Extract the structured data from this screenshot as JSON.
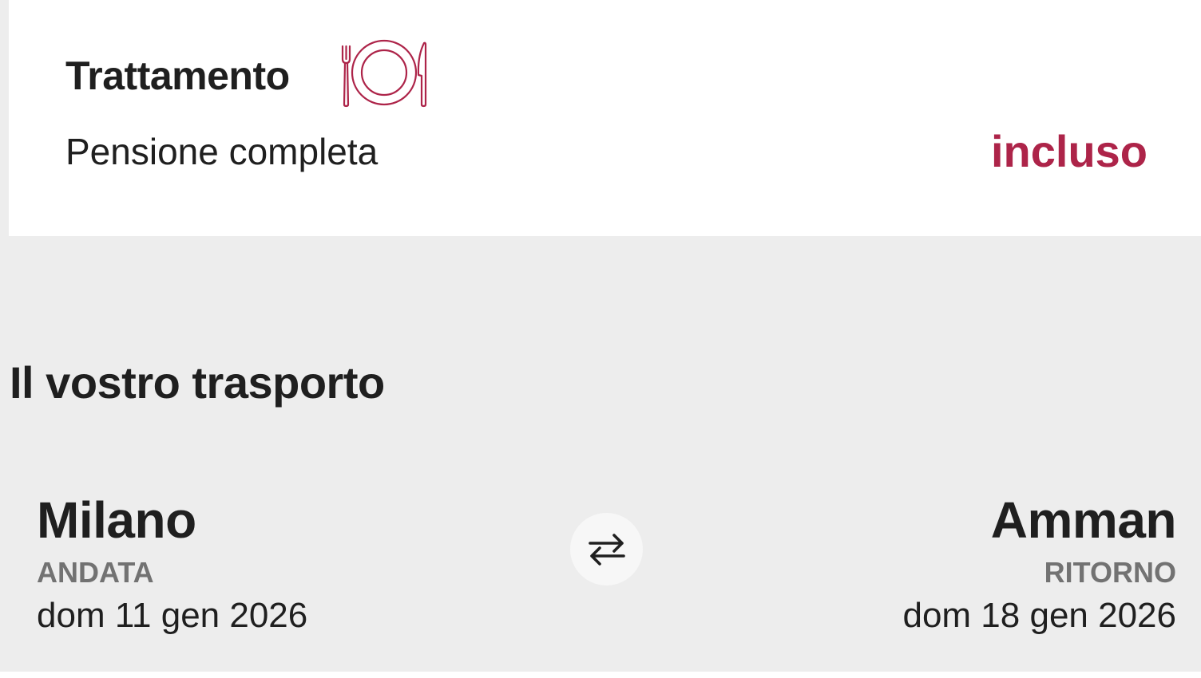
{
  "treatment": {
    "title": "Trattamento",
    "icon": "plate-cutlery-icon",
    "value": "Pensione completa",
    "status": "incluso",
    "accent_color": "#ad2449"
  },
  "transport": {
    "section_title": "Il vostro trasporto",
    "outbound": {
      "city": "Milano",
      "label": "ANDATA",
      "date": "dom 11 gen 2026"
    },
    "swap_icon": "swap-arrows-icon",
    "return": {
      "city": "Amman",
      "label": "RITORNO",
      "date": "dom 18 gen 2026"
    }
  }
}
